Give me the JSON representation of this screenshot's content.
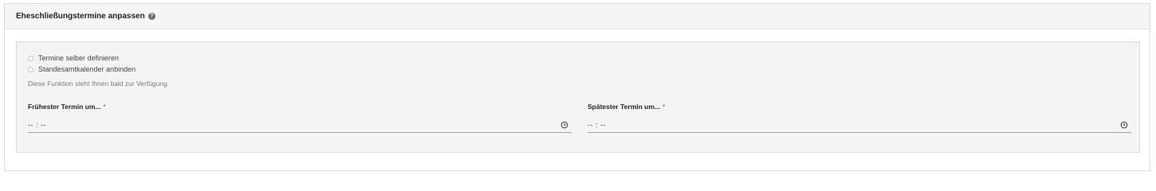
{
  "header": {
    "title": "Eheschließungstermine anpassen",
    "help_icon": "help-circle-icon"
  },
  "options": {
    "radio_1": "Termine selber definieren",
    "radio_2": "Standesamtkalender anbinden",
    "note": "Diese Funktion steht Ihnen bald zur Verfügung"
  },
  "fields": {
    "earliest": {
      "label": "Frühester Termin um...",
      "required_mark": "*",
      "value": "-- : --",
      "icon": "clock-icon"
    },
    "latest": {
      "label": "Spätester Termin um...",
      "required_mark": "*",
      "value": "-- : --",
      "icon": "clock-icon"
    }
  },
  "colors": {
    "required": "#d23c3c",
    "panel": "#f4f4f4",
    "header": "#f5f5f5"
  }
}
